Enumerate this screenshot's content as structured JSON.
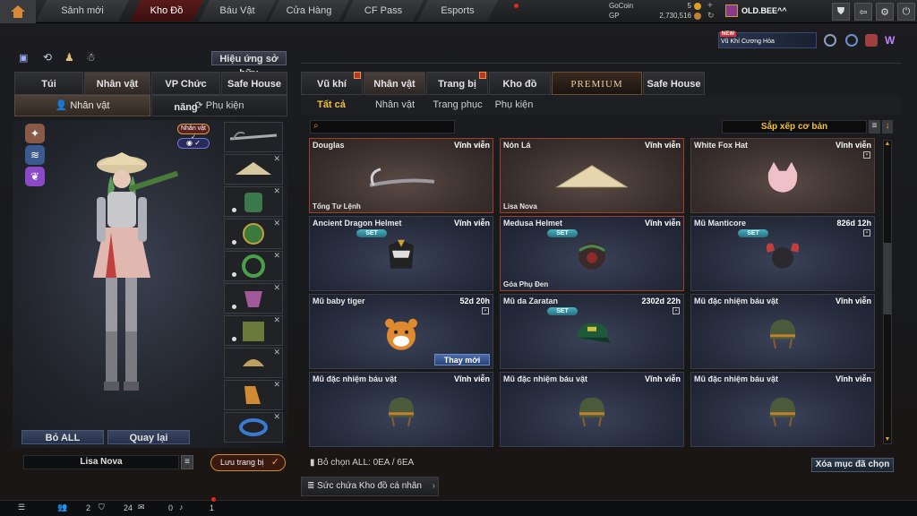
{
  "nav": {
    "tabs": [
      {
        "label": "Sảnh mới",
        "active": false
      },
      {
        "label": "Kho Đồ",
        "active": true
      },
      {
        "label": "Báu Vật",
        "active": false
      },
      {
        "label": "Cửa Hàng",
        "active": false
      },
      {
        "label": "CF Pass",
        "active": false
      },
      {
        "label": "Esports",
        "active": false
      }
    ]
  },
  "currency": {
    "gocoin_label": "GoCoin",
    "gocoin_value": "5",
    "gp_label": "GP",
    "gp_value": "2,730,516"
  },
  "user": {
    "name": "OLD.BEE^^"
  },
  "promo": {
    "badge": "NEW",
    "text": "Vũ Khí Cương Hỏa"
  },
  "left": {
    "effect_button": "Hiệu ứng sở hữu",
    "tabs": [
      "Túi",
      "Nhân vật",
      "VP Chức năng",
      "Safe House"
    ],
    "active_tab": 1,
    "subtabs": [
      "Nhân vật",
      "Phụ kiện"
    ],
    "char_badge": "Nhân vật",
    "bo_all": "Bỏ ALL",
    "quay_lai": "Quay lại",
    "char_name": "Lisa Nova",
    "save_button": "Lưu trang bị"
  },
  "main": {
    "tabs": [
      "Vũ khí",
      "Nhân vật",
      "Trang bị",
      "Kho đồ",
      "PREMIUM",
      "Safe House"
    ],
    "active_tab": 1,
    "subtabs": [
      "Tất cả",
      "Nhân vật",
      "Trang phục",
      "Phụ kiện"
    ],
    "active_subtab": 0,
    "sort_label": "Sắp xếp cơ bản",
    "search_placeholder": "",
    "items": [
      {
        "name": "Douglas",
        "time": "Vĩnh viễn",
        "tag": "Tổng Tư Lệnh",
        "set": false,
        "lock": false,
        "warm": true,
        "sel": true,
        "icon": "scythe"
      },
      {
        "name": "Nón Lá",
        "time": "Vĩnh viễn",
        "tag": "Lisa Nova",
        "set": false,
        "lock": false,
        "warm": true,
        "sel": true,
        "icon": "conical-hat"
      },
      {
        "name": "White Fox Hat",
        "time": "Vĩnh viễn",
        "tag": "",
        "set": false,
        "lock": true,
        "warm": true,
        "sel": false,
        "icon": "fox-hat"
      },
      {
        "name": "Ancient Dragon Helmet",
        "time": "Vĩnh viễn",
        "tag": "",
        "set": true,
        "lock": false,
        "warm": false,
        "sel": false,
        "icon": "dragon-helmet"
      },
      {
        "name": "Medusa Helmet",
        "time": "Vĩnh viễn",
        "tag": "Góa Phụ Đen",
        "set": true,
        "lock": false,
        "warm": false,
        "sel": true,
        "icon": "medusa-helmet"
      },
      {
        "name": "Mũ Manticore",
        "time": "826d 12h",
        "tag": "",
        "set": true,
        "lock": true,
        "warm": false,
        "sel": false,
        "icon": "manticore-helmet"
      },
      {
        "name": "Mũ baby tiger",
        "time": "52d 20h",
        "tag": "",
        "set": false,
        "lock": true,
        "warm": false,
        "sel": false,
        "icon": "tiger-hat",
        "change": "Thay mới"
      },
      {
        "name": "Mũ da Zaratan",
        "time": "2302d 22h",
        "tag": "",
        "set": true,
        "lock": true,
        "warm": false,
        "sel": false,
        "icon": "cap"
      },
      {
        "name": "Mũ đặc nhiệm báu vật",
        "time": "Vĩnh viễn",
        "tag": "",
        "set": false,
        "lock": false,
        "warm": false,
        "sel": false,
        "icon": "tactical-helmet"
      },
      {
        "name": "Mũ đặc nhiệm báu vật",
        "time": "Vĩnh viễn",
        "tag": "",
        "set": false,
        "lock": false,
        "warm": false,
        "sel": false,
        "icon": "tactical-helmet"
      },
      {
        "name": "Mũ đặc nhiệm báu vật",
        "time": "Vĩnh viễn",
        "tag": "",
        "set": false,
        "lock": false,
        "warm": false,
        "sel": false,
        "icon": "tactical-helmet"
      },
      {
        "name": "Mũ đặc nhiệm báu vật",
        "time": "Vĩnh viễn",
        "tag": "",
        "set": false,
        "lock": false,
        "warm": false,
        "sel": false,
        "icon": "tactical-helmet"
      }
    ],
    "deselect_label": "Bỏ chọn ALL: 0EA / 6EA",
    "capacity_label": "Sức chứa Kho đồ cá nhân",
    "delete_button": "Xóa mục đã chọn"
  },
  "bottom": {
    "count1": "2",
    "count2": "24",
    "count3": "0",
    "count4": "1"
  }
}
